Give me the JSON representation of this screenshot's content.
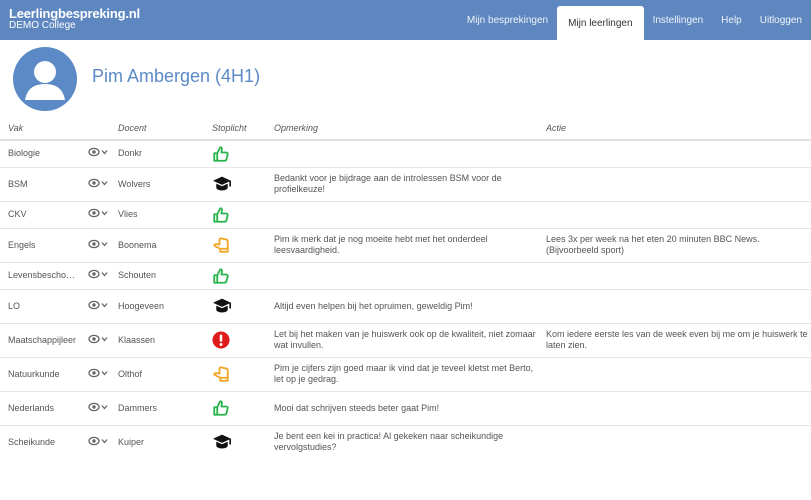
{
  "header": {
    "app_title": "Leerlingbespreking.nl",
    "school": "DEMO College",
    "nav": [
      {
        "label": "Mijn besprekingen",
        "active": false
      },
      {
        "label": "Mijn leerlingen",
        "active": true
      },
      {
        "label": "Instellingen",
        "active": false
      },
      {
        "label": "Help",
        "active": false
      },
      {
        "label": "Uitloggen",
        "active": false
      }
    ]
  },
  "student": {
    "name": "Pim Ambergen (4H1)",
    "avatar_icon": "user-avatar-icon"
  },
  "table": {
    "columns": [
      "Vak",
      "Docent",
      "Stoplicht",
      "Opmerking",
      "Actie"
    ],
    "rows": [
      {
        "vak": "Biologie",
        "docent": "Donkr",
        "status": "thumbs-up",
        "opmerking": "",
        "actie": ""
      },
      {
        "vak": "BSM",
        "docent": "Wolvers",
        "status": "graduation-cap",
        "opmerking": "Bedankt voor je bijdrage aan de introlessen BSM voor de profielkeuze!",
        "actie": ""
      },
      {
        "vak": "CKV",
        "docent": "Vlies",
        "status": "thumbs-up",
        "opmerking": "",
        "actie": ""
      },
      {
        "vak": "Engels",
        "docent": "Boonema",
        "status": "thumbs-neutral",
        "opmerking": "Pim ik merk dat je nog moeite hebt met het onderdeel leesvaardigheid.",
        "actie": "Lees 3x per week na het eten 20 minuten BBC News. (Bijvoorbeeld sport)"
      },
      {
        "vak": "Levensbeschouwing",
        "docent": "Schouten",
        "status": "thumbs-up",
        "opmerking": "",
        "actie": ""
      },
      {
        "vak": "LO",
        "docent": "Hoogeveen",
        "status": "graduation-cap",
        "opmerking": "Altijd even helpen bij het opruimen, geweldig Pim!",
        "actie": ""
      },
      {
        "vak": "Maatschappijleer",
        "docent": "Klaassen",
        "status": "alert",
        "opmerking": "Let bij het maken van je huiswerk ook op de kwaliteit, niet zomaar wat invullen.",
        "actie": "Kom iedere eerste les van de week even bij me om je huiswerk te laten zien."
      },
      {
        "vak": "Natuurkunde",
        "docent": "Olthof",
        "status": "thumbs-neutral",
        "opmerking": "Pim je cijfers zijn goed maar ik vind dat je teveel kletst met Berto, let op je gedrag.",
        "actie": ""
      },
      {
        "vak": "Nederlands",
        "docent": "Dammers",
        "status": "thumbs-up",
        "opmerking": "Mooi dat schrijven steeds beter gaat Pim!",
        "actie": ""
      },
      {
        "vak": "Scheikunde",
        "docent": "Kuiper",
        "status": "graduation-cap",
        "opmerking": "Je bent een kei in practica! Al gekeken naar scheikundige vervolgstudies?",
        "actie": ""
      }
    ]
  },
  "colors": {
    "topbar": "#5e87c0",
    "name": "#5b8ac6",
    "thumbs_up": "#27b34a",
    "thumbs_neutral": "#f0a421",
    "alert": "#e01b1b",
    "cap": "#111111"
  }
}
